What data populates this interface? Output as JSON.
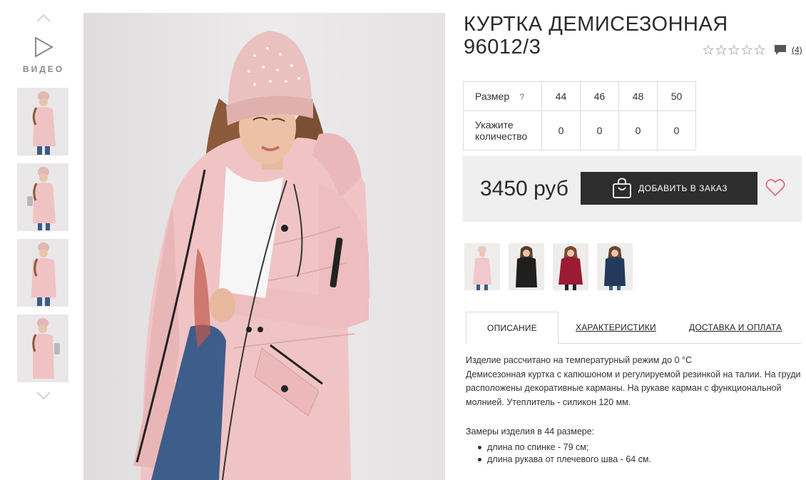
{
  "gallery": {
    "video_label": "ВИДЕО",
    "icons": {
      "up": "chevron-up-icon",
      "down": "chevron-down-icon",
      "play": "play-icon"
    }
  },
  "product": {
    "title": "КУРТКА ДЕМИСЕЗОННАЯ 96012/3",
    "rating": {
      "stars_filled": 0,
      "stars_total": 5,
      "review_count": "(4)"
    }
  },
  "sizes": {
    "size_label": "Размер",
    "help": "?",
    "quantity_label": "Укажите количество",
    "items": [
      {
        "size": "44",
        "qty": "0"
      },
      {
        "size": "46",
        "qty": "0"
      },
      {
        "size": "48",
        "qty": "0"
      },
      {
        "size": "50",
        "qty": "0"
      }
    ]
  },
  "purchase": {
    "price": "3450 руб",
    "add_button": "ДОБАВИТЬ В ЗАКАЗ",
    "colors": {
      "button_bg": "#2d2d2d",
      "heart": "#e06b7c",
      "price_box_bg": "#efefef"
    }
  },
  "color_variants": [
    {
      "name": "pink",
      "color": "#f0c9cc"
    },
    {
      "name": "black",
      "color": "#1f1f1f"
    },
    {
      "name": "burgundy",
      "color": "#9b1a34"
    },
    {
      "name": "navy",
      "color": "#233a5c"
    }
  ],
  "tabs": [
    {
      "label": "ОПИСАНИЕ",
      "active": true
    },
    {
      "label": "ХАРАКТЕРИСТИКИ",
      "active": false
    },
    {
      "label": "ДОСТАВКА И ОПЛАТА",
      "active": false
    }
  ],
  "description": {
    "lines": [
      "Изделие рассчитано на температурный режим до 0 °С",
      "Демисезонная куртка с капюшоном и регулируемой резинкой на талии. На груди расположены декоративные карманы. На рукаве карман с функциональной молнией. Утеплитель - силикон 120 мм."
    ],
    "measurements_title": "Замеры изделия в 44 размере:",
    "measurements": [
      "длина по спинке - 79 см;",
      "длина рукава от плечевого шва - 64 см."
    ]
  }
}
